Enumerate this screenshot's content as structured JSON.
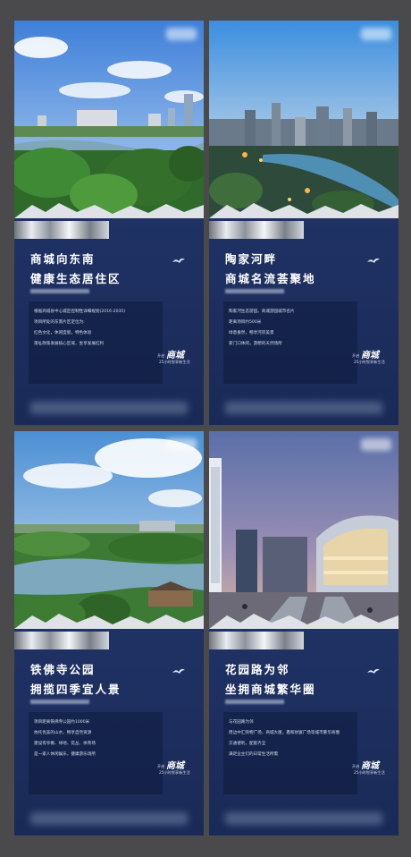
{
  "posters": [
    {
      "title_line1": "商城向东南",
      "title_line2": "健康生态居住区",
      "body_lines": [
        "根据商城县中心城区控制性详细规划(2016-2035)",
        "项目所处的东南片区定位为:",
        "红色文化，休闲度假，特色体验",
        "落址政策发展核心区域，坐享发展红利"
      ],
      "sig_pre": "开启",
      "sig_main": "商城",
      "sig_sub": "25小时悦享新生活"
    },
    {
      "title_line1": "陶家河畔",
      "title_line2": "商城名流荟聚地",
      "body_lines": [
        "陶家河生态游园，商城游园城市名片",
        "距离项目约500米",
        "绿意盎然，畅享河岸美景",
        "家门口休闲，游憩的天然场所"
      ],
      "sig_pre": "开启",
      "sig_main": "商城",
      "sig_sub": "25小时悦享新生活"
    },
    {
      "title_line1": "铁佛寺公园",
      "title_line2": "拥揽四季宜人景",
      "body_lines": [
        "项目距离铁佛寺公园约1000米",
        "依托优美的山水，畅享自然资源",
        "建设有亭榭、绿地、花丛、体育场",
        "是一家人休闲娱乐，健康游乐场所"
      ],
      "sig_pre": "开启",
      "sig_main": "商城",
      "sig_sub": "25小时悦享新生活"
    },
    {
      "title_line1": "花园路为邻",
      "title_line2": "坐拥商城繁华圈",
      "body_lines": [
        "与花园路为邻",
        "周边中汇购物广场，商城大厦，鑫和财富广场等城市繁华商圈",
        "交通便利，配套齐全",
        "满足业主们的日常生活所需"
      ],
      "sig_pre": "开启",
      "sig_main": "商城",
      "sig_sub": "25小时悦享新生活"
    }
  ],
  "colors": {
    "page_background": "#4a4a4c",
    "card_navy": "#23376a",
    "text_white": "#ffffff"
  },
  "icons": [
    "bird-icon",
    "silver-bar"
  ]
}
